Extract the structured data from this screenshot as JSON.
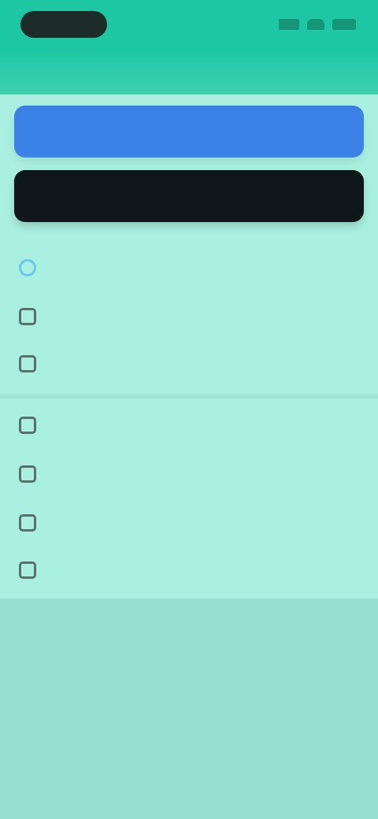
{
  "status_bar": {
    "time": "",
    "icons": [
      "signal-icon",
      "wifi-icon",
      "battery-icon"
    ]
  },
  "header": {
    "title": ""
  },
  "buttons": {
    "primary_label": "",
    "secondary_label": ""
  },
  "menu": {
    "items": [
      {
        "label": "",
        "icon": "home-icon",
        "active": true
      },
      {
        "label": "",
        "icon": "folder-icon"
      },
      {
        "label": "",
        "icon": "document-icon"
      },
      {
        "label": "",
        "icon": "settings-icon"
      },
      {
        "label": "",
        "icon": "star-icon"
      },
      {
        "label": "",
        "icon": "people-icon"
      },
      {
        "label": "",
        "icon": "info-icon"
      }
    ]
  },
  "colors": {
    "header": "#1ec7a4",
    "panel": "#aaf0e0",
    "background": "#95ded1",
    "primary_button": "#3b82e6",
    "dark_button": "#0f1718",
    "active_item": "#5cc3f0"
  }
}
